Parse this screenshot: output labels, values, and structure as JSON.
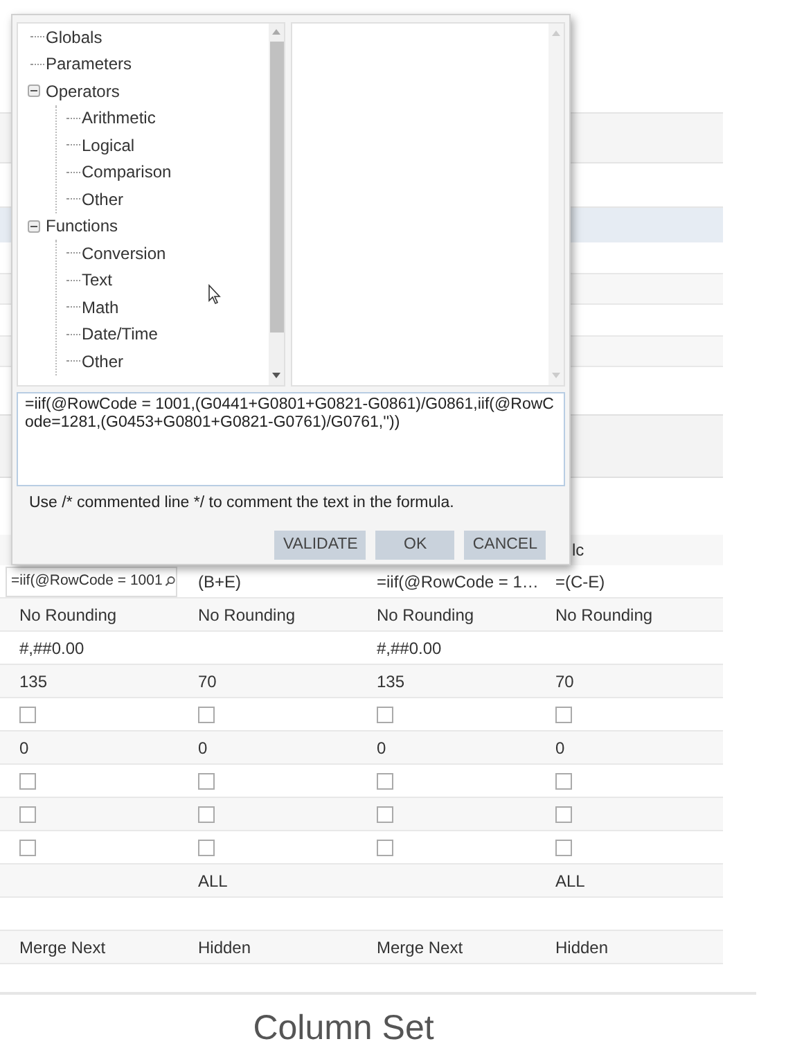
{
  "dialog": {
    "tree": [
      {
        "label": "Globals"
      },
      {
        "label": "Parameters"
      },
      {
        "label": "Operators",
        "expanded": true,
        "children": [
          {
            "label": "Arithmetic"
          },
          {
            "label": "Logical"
          },
          {
            "label": "Comparison"
          },
          {
            "label": "Other"
          }
        ]
      },
      {
        "label": "Functions",
        "expanded": true,
        "children": [
          {
            "label": "Conversion"
          },
          {
            "label": "Text"
          },
          {
            "label": "Math"
          },
          {
            "label": "Date/Time"
          },
          {
            "label": "Other"
          }
        ]
      }
    ],
    "formula": "=iif(@RowCode = 1001,(G0441+G0801+G0821-G0861)/G0861,iif(@RowCode=1281,(G0453+G0801+G0821-G0761)/G0761,''))",
    "hint": "Use /* commented line */ to comment the text in the formula.",
    "buttons": [
      "VALIDATE",
      "OK",
      "CANCEL"
    ]
  },
  "behind_row_text": "lc",
  "grid": {
    "rows": [
      {
        "cells": [
          {
            "kind": "input",
            "value": "=iif(@RowCode = 1001"
          },
          {
            "kind": "text",
            "text": "(B+E)"
          },
          {
            "kind": "text",
            "text": "=iif(@RowCode = 1…"
          },
          {
            "kind": "text",
            "text": "=(C-E)"
          }
        ]
      },
      {
        "cells": [
          {
            "kind": "text",
            "text": "No Rounding"
          },
          {
            "kind": "text",
            "text": "No Rounding"
          },
          {
            "kind": "text",
            "text": "No Rounding"
          },
          {
            "kind": "text",
            "text": "No Rounding"
          }
        ]
      },
      {
        "cells": [
          {
            "kind": "text",
            "text": "#,##0.00"
          },
          {
            "kind": "empty"
          },
          {
            "kind": "text",
            "text": "#,##0.00"
          },
          {
            "kind": "empty"
          }
        ]
      },
      {
        "cells": [
          {
            "kind": "text",
            "text": "135"
          },
          {
            "kind": "text",
            "text": "70"
          },
          {
            "kind": "text",
            "text": "135"
          },
          {
            "kind": "text",
            "text": "70"
          }
        ]
      },
      {
        "cells": [
          {
            "kind": "checkbox",
            "checked": false
          },
          {
            "kind": "checkbox",
            "checked": false
          },
          {
            "kind": "checkbox",
            "checked": false
          },
          {
            "kind": "checkbox",
            "checked": false
          }
        ]
      },
      {
        "cells": [
          {
            "kind": "text",
            "text": "0"
          },
          {
            "kind": "text",
            "text": "0"
          },
          {
            "kind": "text",
            "text": "0"
          },
          {
            "kind": "text",
            "text": "0"
          }
        ]
      },
      {
        "cells": [
          {
            "kind": "checkbox",
            "checked": false
          },
          {
            "kind": "checkbox",
            "checked": false
          },
          {
            "kind": "checkbox",
            "checked": false
          },
          {
            "kind": "checkbox",
            "checked": false
          }
        ]
      },
      {
        "cells": [
          {
            "kind": "checkbox",
            "checked": false
          },
          {
            "kind": "checkbox",
            "checked": false
          },
          {
            "kind": "checkbox",
            "checked": false
          },
          {
            "kind": "checkbox",
            "checked": false
          }
        ]
      },
      {
        "cells": [
          {
            "kind": "checkbox",
            "checked": false
          },
          {
            "kind": "checkbox",
            "checked": false
          },
          {
            "kind": "checkbox",
            "checked": false
          },
          {
            "kind": "checkbox",
            "checked": false
          }
        ]
      },
      {
        "cells": [
          {
            "kind": "empty"
          },
          {
            "kind": "text",
            "text": "ALL"
          },
          {
            "kind": "empty"
          },
          {
            "kind": "text",
            "text": "ALL"
          }
        ]
      },
      {
        "cells": [
          {
            "kind": "empty"
          },
          {
            "kind": "empty"
          },
          {
            "kind": "empty"
          },
          {
            "kind": "empty"
          }
        ]
      },
      {
        "cells": [
          {
            "kind": "text",
            "text": "Merge Next"
          },
          {
            "kind": "text",
            "text": "Hidden"
          },
          {
            "kind": "text",
            "text": "Merge Next"
          },
          {
            "kind": "text",
            "text": "Hidden"
          }
        ]
      }
    ]
  },
  "footer_title": "Column Set"
}
